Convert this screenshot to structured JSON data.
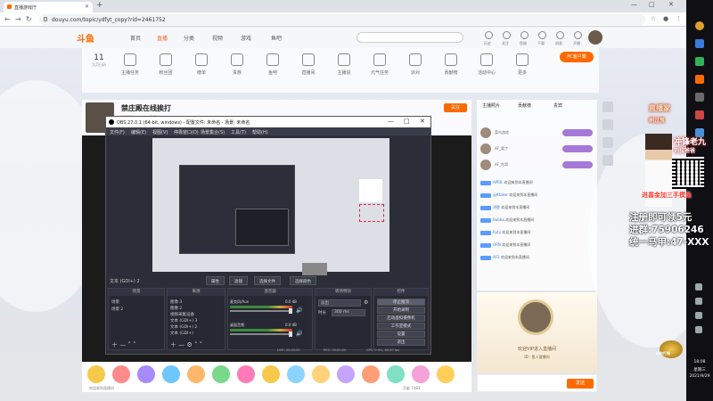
{
  "browser": {
    "tab_title": "直播游戏厅",
    "url": "douyu.com/topic/ydfyt_copy?rid=2461752",
    "new_tab": "+",
    "window_controls": [
      "—",
      "□",
      "✕"
    ]
  },
  "site": {
    "logo": "斗鱼",
    "nav": [
      "首页",
      "直播",
      "分类",
      "视频",
      "游戏",
      "鱼吧"
    ],
    "active_nav": "直播",
    "header_icons": [
      "历史",
      "关注",
      "鱼翅",
      "下载",
      "消息",
      "开播"
    ],
    "date": {
      "day": "11",
      "month": "九月日历"
    },
    "categories": [
      "主播任务",
      "粉丝团",
      "榜单",
      "贵族",
      "鱼吧",
      "直播间",
      "主播说",
      "元气任务",
      "派对",
      "贡献榜",
      "活动中心",
      "更多"
    ],
    "pc_button": "PC客户端"
  },
  "room": {
    "title": "禁庄殿在线挨打",
    "subtitle": "娱乐天地 · 户外 · 直播中",
    "follow_label": "关注"
  },
  "barrage": {
    "tabs": [
      "主播照片",
      "贡献榜",
      "贵宾"
    ],
    "top_users": [
      "菜鸟游戏",
      "AF_奥丁",
      "AF_鸟哥"
    ],
    "messages": [
      {
        "lv": "24",
        "name": "APRIL",
        "text": "欢迎来到本直播间"
      },
      {
        "lv": "21",
        "name": "云Ktaker",
        "text": "欢迎来到本直播间"
      },
      {
        "lv": "18",
        "name": "鸿胜",
        "text": "欢迎来到本直播间"
      },
      {
        "lv": "16",
        "name": "Bubba",
        "text": "欢迎来到本直播间"
      },
      {
        "lv": "12",
        "name": "Ruty",
        "text": "欢迎来到本直播间"
      },
      {
        "lv": "19",
        "name": "ORN",
        "text": "欢迎来到本直播间"
      },
      {
        "lv": "15",
        "name": "AF2",
        "text": "欢迎来到本直播间"
      }
    ],
    "vip_text": "欢迎VIP进入直播间",
    "vip_sub": "ID：鱼人直播间",
    "send_label": "发送"
  },
  "gift_bar": {
    "hint": "欢迎来到直播间",
    "count": "贡献 7483"
  },
  "obs": {
    "title": "OBS 27.0.1 (64-bit, windows) - 配置文件: 未命名 - 场景: 未命名",
    "menu": [
      "文件(F)",
      "编辑(E)",
      "视图(V)",
      "停靠窗口(D)",
      "场景集合(S)",
      "工具(T)",
      "帮助(H)"
    ],
    "source_label": "文本 (GDI+) 2",
    "prop_buttons": [
      "属性",
      "滤镜",
      "选择文件",
      "选择颜色"
    ],
    "scenes_header": "场景",
    "scenes": [
      "场景",
      "场景 2"
    ],
    "sources_header": "来源",
    "sources": [
      "图像 3",
      "图像 2",
      "视频采集设备",
      "文本 (GDI+) 3",
      "文本 (GDI+) 2",
      "文本 (GDI+)"
    ],
    "mixer_header": "混音器",
    "mixer": [
      {
        "label": "麦克风/Aux",
        "value": "0.0 dB"
      },
      {
        "label": "桌面音频",
        "value": "0.0 dB"
      }
    ],
    "transition_header": "转场特效",
    "transition": "淡出",
    "duration_label": "时长",
    "duration": "300 ms",
    "controls_header": "控件",
    "controls": [
      "停止推流",
      "开始录制",
      "启动虚拟摄像机",
      "工作室模式",
      "设置",
      "退出"
    ],
    "status": [
      "LIVE: 00:00:00",
      "REC: 00:00:00",
      "CPU: 0.9%, 60.00 fps"
    ]
  },
  "taskbar": {
    "time": "18:08",
    "weekday": "星期三",
    "date": "2021/9/29"
  },
  "promo": {
    "poster_big": "冲锋老九",
    "poster_small": "刘拉爸爸",
    "poster_slogan": "进喜金加三手摸鱼",
    "side_title": "直播家",
    "side_tag": "刷过鬼",
    "lines": [
      "注册即可领5元",
      "进群:75906246",
      "统一马甲:47-XXX"
    ],
    "emblem": "给你打钱"
  },
  "colors": {
    "brand": "#ff6a00",
    "obs_bg": "#2b2e38",
    "nav_active": "#ff5d23"
  }
}
